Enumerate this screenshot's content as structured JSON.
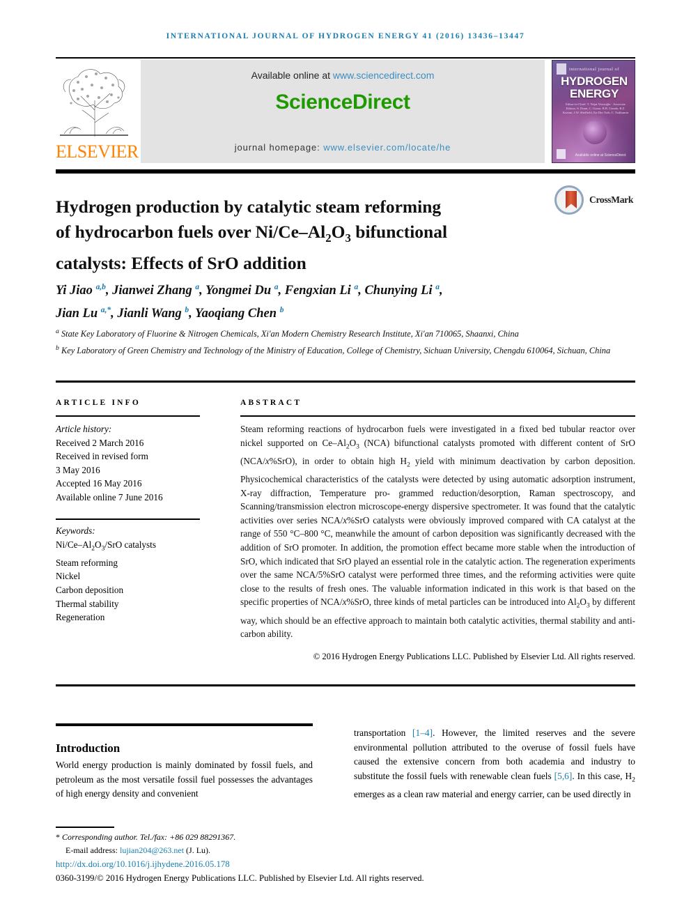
{
  "running_head": "International Journal of Hydrogen Energy 41 (2016) 13436–13447",
  "masthead": {
    "publisher_name": "ELSEVIER",
    "publisher_logo_icon": "elsevier-tree-icon",
    "available_prefix": "Available online at ",
    "available_url": "www.sciencedirect.com",
    "sciencedirect_logo": "ScienceDirect",
    "homepage_prefix": "journal homepage: ",
    "homepage_url": "www.elsevier.com/locate/he",
    "cover": {
      "small_caption": "international journal of",
      "title_line1": "HYDROGEN",
      "title_line2": "ENERGY",
      "editors": "Editor-in-Chief: T. Nejat Veziroğlu · Associate Editors: S. Dunn, C. Gurau, R.R. Llanda, R.Z. Kazimi, J.W. Sheffield, Ka-Din Tseh, C. Yodkumin",
      "bottom_mark": "Available online at ScienceDirect"
    }
  },
  "title": {
    "line1": "Hydrogen production by catalytic steam reforming",
    "line2_a": "of hydrocarbon fuels over Ni/Ce–Al",
    "line2_sub1": "2",
    "line2_b": "O",
    "line2_sub2": "3",
    "line2_c": " bifunctional",
    "line3": "catalysts: Effects of SrO addition"
  },
  "crossmark": {
    "label": "CrossMark",
    "icon": "crossmark-icon"
  },
  "authors": {
    "line1": "Yi Jiao ",
    "sup1": "a,b",
    "line1b": ", Jianwei Zhang ",
    "sup2": "a",
    "line1c": ", Yongmei Du ",
    "sup3": "a",
    "line1d": ", Fengxian Li ",
    "sup4": "a",
    "line1e": ", Chunying Li ",
    "sup5": "a",
    "line1f": ",",
    "line2": "Jian Lu ",
    "sup6": "a,*",
    "line2b": ", Jianli Wang ",
    "sup7": "b",
    "line2c": ", Yaoqiang Chen ",
    "sup8": "b"
  },
  "affiliations": [
    {
      "marker": "a",
      "text": "State Key Laboratory of Fluorine & Nitrogen Chemicals, Xi'an Modern Chemistry Research Institute, Xi'an 710065, Shaanxi, China"
    },
    {
      "marker": "b",
      "text": "Key Laboratory of Green Chemistry and Technology of the Ministry of Education, College of Chemistry, Sichuan University, Chengdu 610064, Sichuan, China"
    }
  ],
  "article_info": {
    "heading": "ARTICLE INFO",
    "history_label": "Article history:",
    "history": [
      "Received 2 March 2016",
      "Received in revised form",
      "3 May 2016",
      "Accepted 16 May 2016",
      "Available online 7 June 2016"
    ],
    "keywords_label": "Keywords:",
    "keywords": [
      "Ni/Ce–Al2O3/SrO catalysts",
      "Steam reforming",
      "Nickel",
      "Carbon deposition",
      "Thermal stability",
      "Regeneration"
    ]
  },
  "abstract": {
    "heading": "ABSTRACT",
    "body": "Steam reforming reactions of hydrocarbon fuels were investigated in a fixed bed tubular reactor over nickel supported on Ce–Al2O3 (NCA) bifunctional catalysts promoted with different content of SrO (NCA/x%SrO), in order to obtain high H2 yield with minimum deactivation by carbon deposition. Physicochemical characteristics of the catalysts were detected by using automatic adsorption instrument, X-ray diffraction, Temperature programmed reduction/desorption, Raman spectroscopy, and Scanning/transmission electron microscope-energy dispersive spectrometer. It was found that the catalytic activities over series NCA/x%SrO catalysts were obviously improved compared with CA catalyst at the range of 550 °C–800 °C, meanwhile the amount of carbon deposition was significantly decreased with the addition of SrO promoter. In addition, the promotion effect became more stable when the introduction of SrO, which indicated that SrO played an essential role in the catalytic action. The regeneration experiments over the same NCA/5%SrO catalyst were performed three times, and the reforming activities were quite close to the results of fresh ones. The valuable information indicated in this work is that based on the specific properties of NCA/x%SrO, three kinds of metal particles can be introduced into Al2O3 by different way, which should be an effective approach to maintain both catalytic activities, thermal stability and anti-carbon ability.",
    "copyright": "© 2016 Hydrogen Energy Publications LLC. Published by Elsevier Ltd. All rights reserved."
  },
  "body": {
    "section_heading": "Introduction",
    "left_paragraph": "World energy production is mainly dominated by fossil fuels, and petroleum as the most versatile fossil fuel possesses the advantages of high energy density and convenient",
    "right_part1": "transportation ",
    "right_ref1": "[1–4]",
    "right_part2": ". However, the limited reserves and the severe environmental pollution attributed to the overuse of fossil fuels have caused the extensive concern from both academia and industry to substitute the fossil fuels with renewable clean fuels ",
    "right_ref2": "[5,6]",
    "right_part3": ". In this case, H2 emerges as a clean raw material and energy carrier, can be used directly in"
  },
  "footer": {
    "corresponding_star": "*",
    "corresponding": " Corresponding author. Tel./fax: +86 029 88291367.",
    "email_label": "E-mail address: ",
    "email": "lujian204@263.net",
    "email_suffix": " (J. Lu).",
    "doi": "http://dx.doi.org/10.1016/j.ijhydene.2016.05.178",
    "issn_line": "0360-3199/© 2016 Hydrogen Energy Publications LLC. Published by Elsevier Ltd. All rights reserved."
  },
  "colors": {
    "link_blue": "#1a7db0",
    "sciencedirect_green": "#1e9900",
    "elsevier_orange": "#ff8200",
    "masthead_gray": "#e3e3e3"
  }
}
